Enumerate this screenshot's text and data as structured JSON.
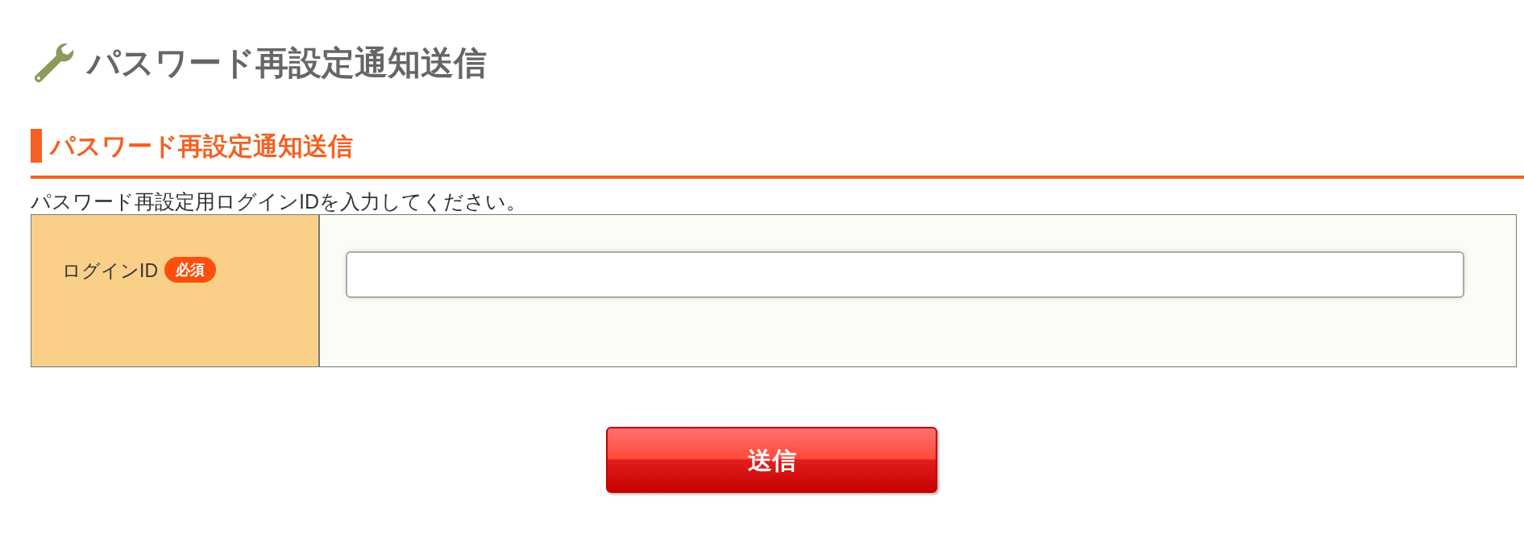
{
  "page_title": "パスワード再設定通知送信",
  "section_heading": "パスワード再設定通知送信",
  "instruction": "パスワード再設定用ログインIDを入力してください。",
  "form_rows": [
    {
      "label": "ログインID",
      "badge": "必須",
      "kind": "text"
    }
  ],
  "submit_button": "送信"
}
